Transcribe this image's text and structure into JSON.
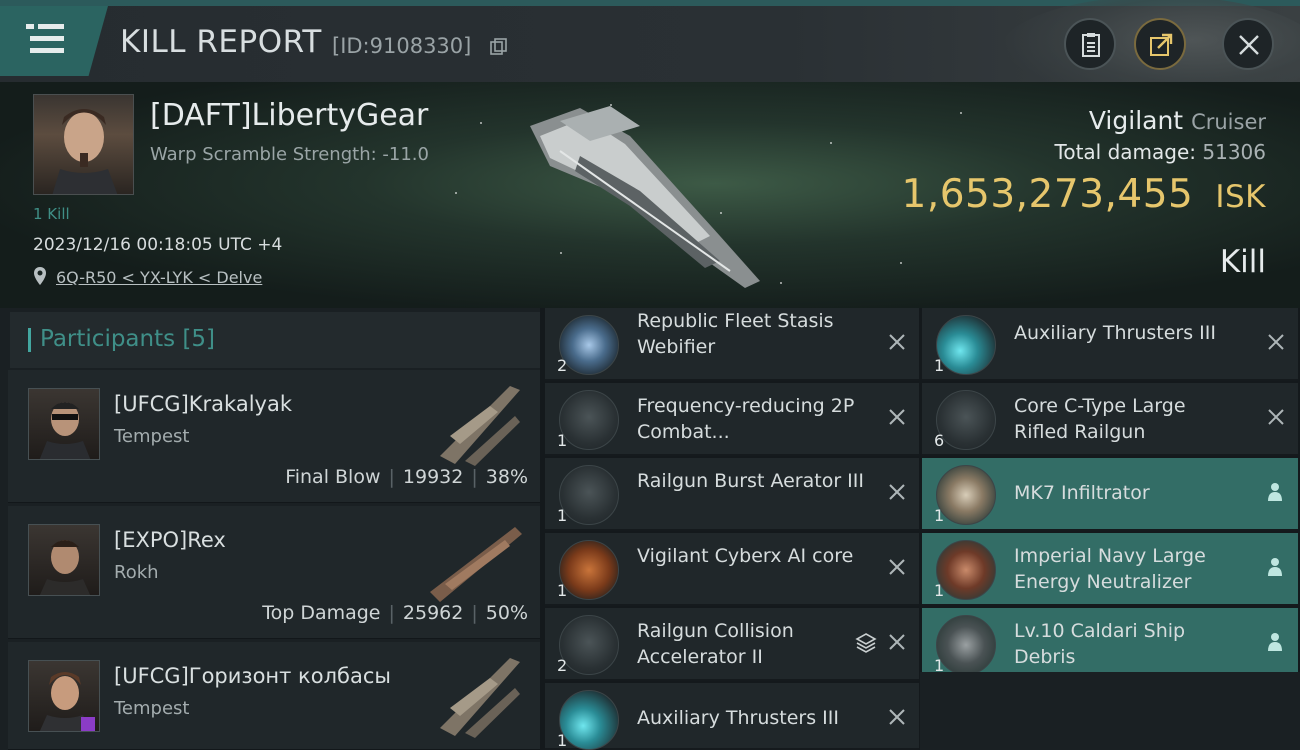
{
  "header": {
    "title": "KILL REPORT",
    "kill_id": "[ID:9108330]"
  },
  "victim": {
    "name": "[DAFT]LibertyGear",
    "warp": "Warp Scramble Strength: -11.0",
    "kill_count": "1 Kill",
    "datetime": "2023/12/16 00:18:05 UTC +4",
    "location": "6Q-R50 < YX-LYK < Delve",
    "ship_name": "Vigilant",
    "ship_class": "Cruiser",
    "total_damage_label": "Total damage:",
    "total_damage_value": "51306",
    "isk_value": "1,653,273,455",
    "isk_unit": "ISK",
    "result": "Kill"
  },
  "participants": {
    "label": "Participants",
    "count": "[5]",
    "rows": [
      {
        "name": "[UFCG]Krakalyak",
        "ship": "Tempest",
        "tag": "Final Blow",
        "damage": "19932",
        "percent": "38%"
      },
      {
        "name": "[EXPO]Rex",
        "ship": "Rokh",
        "tag": "Top Damage",
        "damage": "25962",
        "percent": "50%"
      },
      {
        "name": "[UFCG]Горизонт колбасы",
        "ship": "Tempest",
        "tag": "",
        "damage": "",
        "percent": ""
      }
    ]
  },
  "items_col1": [
    {
      "qty": "2",
      "name": "Republic Fleet Stasis Webifier"
    },
    {
      "qty": "1",
      "name": "Frequency-reducing 2P Combat..."
    },
    {
      "qty": "1",
      "name": "Railgun Burst Aerator III"
    },
    {
      "qty": "1",
      "name": "Vigilant Cyberx AI core"
    },
    {
      "qty": "2",
      "name": "Railgun Collision Accelerator II"
    },
    {
      "qty": "1",
      "name": "Auxiliary Thrusters III"
    }
  ],
  "items_col2": [
    {
      "qty": "1",
      "name": "Auxiliary Thrusters III"
    },
    {
      "qty": "6",
      "name": "Core C-Type Large Rifled Railgun"
    },
    {
      "qty": "1",
      "name": "MK7 Infiltrator"
    },
    {
      "qty": "1",
      "name": "Imperial Navy Large Energy Neutralizer"
    },
    {
      "qty": "1",
      "name": "Lv.10 Caldari Ship Debris"
    }
  ],
  "colors": {
    "accent_teal": "#336d66",
    "isk_gold": "#e6c66c"
  }
}
